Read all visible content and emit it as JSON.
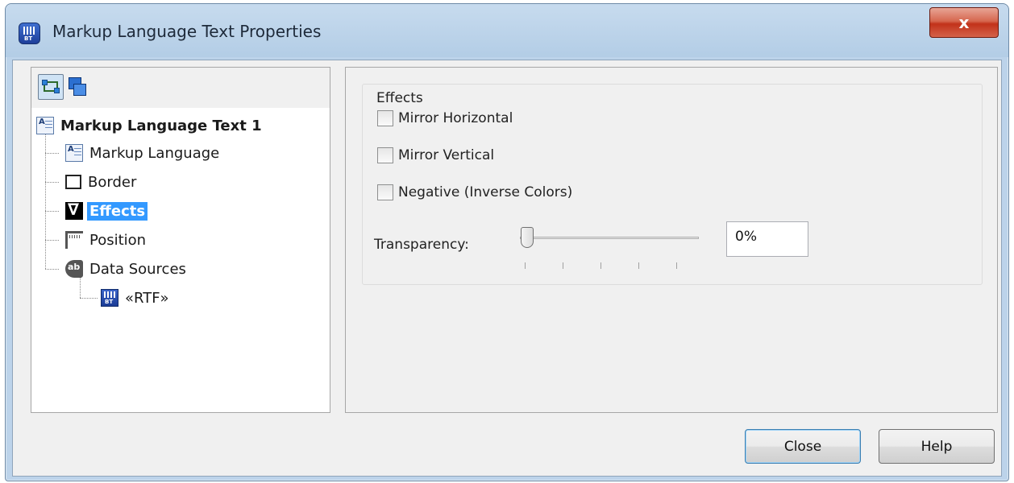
{
  "window": {
    "title": "Markup Language Text Properties",
    "close_glyph": "x"
  },
  "tree": {
    "root": "Markup Language Text 1",
    "items": [
      "Markup Language",
      "Border",
      "Effects",
      "Position",
      "Data Sources"
    ],
    "sub_item": "«RTF»",
    "selected": "Effects"
  },
  "effects": {
    "group_title": "Effects",
    "checkboxes": [
      {
        "label": "Mirror Horizontal",
        "checked": false
      },
      {
        "label": "Mirror Vertical",
        "checked": false
      },
      {
        "label": "Negative (Inverse Colors)",
        "checked": false
      }
    ],
    "transparency_label": "Transparency:",
    "transparency_value": "0%",
    "transparency_level": 0
  },
  "buttons": {
    "close": "Close",
    "help": "Help"
  },
  "colors": {
    "selection": "#3399ff",
    "dialog_bg": "#f0f0f0",
    "title_close": "#c2321a"
  }
}
